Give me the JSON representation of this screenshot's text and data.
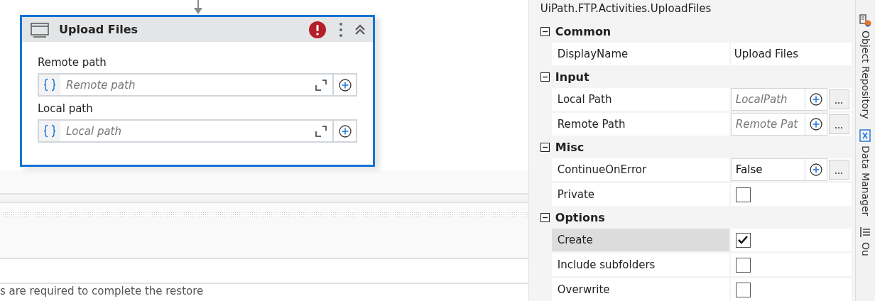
{
  "activity": {
    "title": "Upload Files",
    "error": true,
    "fields": [
      {
        "label": "Remote path",
        "placeholder": "Remote path"
      },
      {
        "label": "Local path",
        "placeholder": "Local path"
      }
    ]
  },
  "output_panel": {
    "message": "s are required to complete the restore"
  },
  "properties": {
    "type_name": "UiPath.FTP.Activities.UploadFiles",
    "categories": [
      {
        "name": "Common",
        "expanded": true,
        "rows": [
          {
            "kind": "text",
            "name": "DisplayName",
            "value": "Upload Files",
            "selected": false
          }
        ]
      },
      {
        "name": "Input",
        "expanded": true,
        "rows": [
          {
            "kind": "expression",
            "name": "Local Path",
            "placeholder": "LocalPath",
            "selected": false
          },
          {
            "kind": "expression",
            "name": "Remote Path",
            "placeholder": "Remote Pat",
            "selected": false
          }
        ]
      },
      {
        "name": "Misc",
        "expanded": true,
        "rows": [
          {
            "kind": "expression",
            "name": "ContinueOnError",
            "value": "False",
            "selected": false
          },
          {
            "kind": "checkbox",
            "name": "Private",
            "checked": false,
            "selected": false
          }
        ]
      },
      {
        "name": "Options",
        "expanded": true,
        "rows": [
          {
            "kind": "checkbox",
            "name": "Create",
            "checked": true,
            "selected": true
          },
          {
            "kind": "checkbox",
            "name": "Include subfolders",
            "checked": false,
            "selected": false
          },
          {
            "kind": "checkbox",
            "name": "Overwrite",
            "checked": false,
            "selected": false
          }
        ]
      }
    ]
  },
  "side_tabs": [
    {
      "label": "Object Repository"
    },
    {
      "label": "Data Manager"
    },
    {
      "label": "Ou"
    }
  ]
}
